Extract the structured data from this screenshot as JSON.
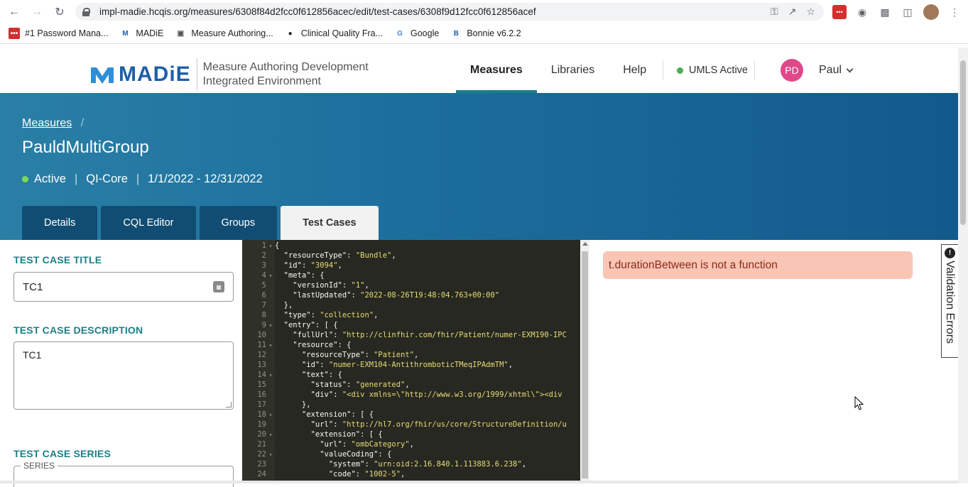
{
  "browser": {
    "url": "impl-madie.hcqis.org/measures/6308f84d2fcc0f612856acec/edit/test-cases/6308f9d12fcc0f612856acef",
    "bookmarks": [
      {
        "label": "#1 Password Mana...",
        "icon": "password-manager-icon",
        "color": "#d32f2f"
      },
      {
        "label": "MADiE",
        "icon": "madie-icon",
        "color": "#1f5fa8"
      },
      {
        "label": "Measure Authoring...",
        "icon": "cms-icon",
        "color": "#555555"
      },
      {
        "label": "Clinical Quality Fra...",
        "icon": "github-icon",
        "color": "#222222"
      },
      {
        "label": "Google",
        "icon": "google-icon",
        "color": "#4285f4"
      },
      {
        "label": "Bonnie v6.2.2",
        "icon": "bonnie-icon",
        "color": "#1f5fa8"
      }
    ]
  },
  "header": {
    "logo_text": "MADiE",
    "subtitle_line1": "Measure Authoring Development",
    "subtitle_line2": "Integrated Environment",
    "nav": [
      "Measures",
      "Libraries",
      "Help"
    ],
    "active_nav": "Measures",
    "umls_status": "UMLS Active",
    "user_initials": "PD",
    "user_name": "Paul"
  },
  "hero": {
    "breadcrumb": "Measures",
    "breadcrumb_sep": "/",
    "measure_name": "PauldMultiGroup",
    "status": "Active",
    "model": "QI-Core",
    "period": "1/1/2022 - 12/31/2022",
    "tabs": [
      "Details",
      "CQL Editor",
      "Groups",
      "Test Cases"
    ],
    "active_tab": "Test Cases"
  },
  "form": {
    "title_label": "TEST CASE TITLE",
    "title_value": "TC1",
    "description_label": "TEST CASE DESCRIPTION",
    "description_value": "TC1",
    "series_label": "TEST CASE SERIES",
    "series_legend": "SERIES"
  },
  "editor": {
    "lines": [
      {
        "n": "1",
        "fold": true,
        "text": "{"
      },
      {
        "n": "2",
        "fold": false,
        "text": "  \"resourceType\": \"Bundle\","
      },
      {
        "n": "3",
        "fold": false,
        "text": "  \"id\": \"3094\","
      },
      {
        "n": "4",
        "fold": true,
        "text": "  \"meta\": {"
      },
      {
        "n": "5",
        "fold": false,
        "text": "    \"versionId\": \"1\","
      },
      {
        "n": "6",
        "fold": false,
        "text": "    \"lastUpdated\": \"2022-08-26T19:48:04.763+00:00\""
      },
      {
        "n": "7",
        "fold": false,
        "text": "  },"
      },
      {
        "n": "8",
        "fold": false,
        "text": "  \"type\": \"collection\","
      },
      {
        "n": "9",
        "fold": true,
        "text": "  \"entry\": [ {"
      },
      {
        "n": "10",
        "fold": false,
        "text": "    \"fullUrl\": \"http://clinfhir.com/fhir/Patient/numer-EXM190-IPC"
      },
      {
        "n": "11",
        "fold": true,
        "text": "    \"resource\": {"
      },
      {
        "n": "12",
        "fold": false,
        "text": "      \"resourceType\": \"Patient\","
      },
      {
        "n": "13",
        "fold": false,
        "text": "      \"id\": \"numer-EXM104-AntithromboticTMeqIPAdmTM\","
      },
      {
        "n": "14",
        "fold": true,
        "text": "      \"text\": {"
      },
      {
        "n": "15",
        "fold": false,
        "text": "        \"status\": \"generated\","
      },
      {
        "n": "16",
        "fold": false,
        "text": "        \"div\": \"<div xmlns=\\\"http://www.w3.org/1999/xhtml\\\"><div"
      },
      {
        "n": "17",
        "fold": false,
        "text": "      },"
      },
      {
        "n": "18",
        "fold": true,
        "text": "      \"extension\": [ {"
      },
      {
        "n": "19",
        "fold": false,
        "text": "        \"url\": \"http://hl7.org/fhir/us/core/StructureDefinition/u"
      },
      {
        "n": "20",
        "fold": true,
        "text": "        \"extension\": [ {"
      },
      {
        "n": "21",
        "fold": false,
        "text": "          \"url\": \"ombCategory\","
      },
      {
        "n": "22",
        "fold": true,
        "text": "          \"valueCoding\": {"
      },
      {
        "n": "23",
        "fold": false,
        "text": "            \"system\": \"urn:oid:2.16.840.1.113883.6.238\","
      },
      {
        "n": "24",
        "fold": false,
        "text": "            \"code\": \"1002-5\","
      }
    ]
  },
  "validation": {
    "error_message": "t.durationBetween is not a function",
    "panel_label": "Validation Errors",
    "icon": "alert-circle-icon"
  },
  "colors": {
    "brand": "#1f5fa8",
    "accent": "#1b7f87",
    "hero_start": "#2a7fa6",
    "hero_end": "#135a8c",
    "error_bg": "#f9c5b5",
    "editor_bg": "#272822"
  }
}
